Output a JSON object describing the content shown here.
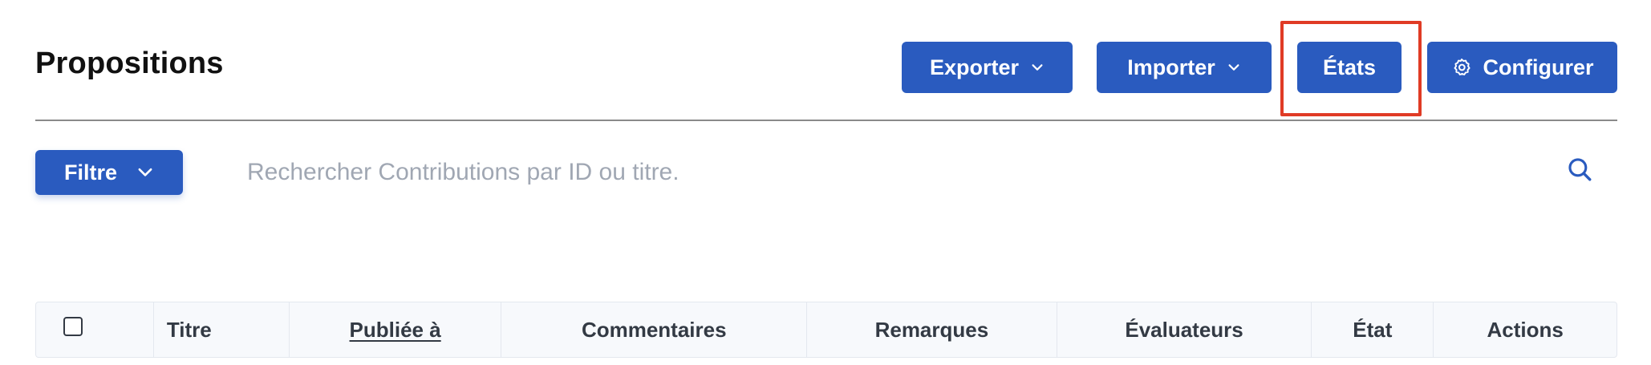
{
  "header": {
    "title": "Propositions",
    "buttons": {
      "export_label": "Exporter",
      "import_label": "Importer",
      "states_label": "États",
      "configure_label": "Configurer"
    }
  },
  "filter": {
    "label": "Filtre"
  },
  "search": {
    "placeholder": "Rechercher Contributions par ID ou titre.",
    "value": ""
  },
  "table": {
    "columns": [
      "Titre",
      "Publiée à",
      "Commentaires",
      "Remarques",
      "Évaluateurs",
      "État",
      "Actions"
    ],
    "select_all_checked": false
  },
  "colors": {
    "primary": "#2a5bbf",
    "highlight": "#e03b25",
    "header_bg": "#f7f9fc"
  },
  "icons": {
    "dropdown": "chevron-down-icon",
    "configure": "gear-icon",
    "search": "search-icon"
  }
}
